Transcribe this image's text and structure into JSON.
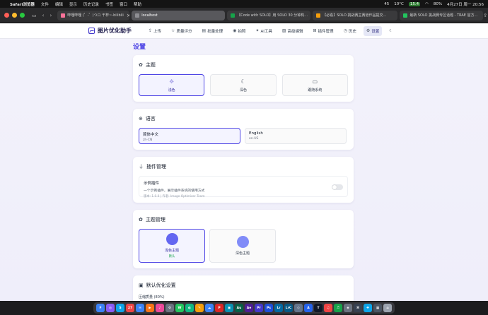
{
  "menubar": {
    "app": "Safari浏览器",
    "items": [
      "文件",
      "编辑",
      "显示",
      "历史记录",
      "书签",
      "窗口",
      "帮助"
    ],
    "status": {
      "num": "45",
      "temp": "10°C",
      "badge": "15.4",
      "battery": "80%",
      "datetime": "4月27日 周一 20:56"
    }
  },
  "browser": {
    "tabs": [
      {
        "label": "哔哩哔哩 (゜-゜)つロ 干杯~-bilibili",
        "color": "#fb7299"
      },
      {
        "label": "localhost",
        "color": "#8e8e93",
        "active": true
      },
      {
        "label": "【Code with SOLO】用 SOLO 30 分钟构...",
        "color": "#16a34a"
      },
      {
        "label": "【必看】SOLO 挑战赛主赛道作品提交...",
        "color": "#f59e0b"
      },
      {
        "label": "最新 SOLO 挑战赛专区话题 - TRAE 官方...",
        "color": "#22c55e"
      }
    ]
  },
  "app": {
    "brand": "图片优化助手",
    "nav": [
      {
        "label": "上传",
        "icon": "upload-icon",
        "glyph": "⇪"
      },
      {
        "label": "质量评分",
        "icon": "star-icon",
        "glyph": "☆"
      },
      {
        "label": "批量处理",
        "icon": "layers-icon",
        "glyph": "▤"
      },
      {
        "label": "拍照",
        "icon": "camera-icon",
        "glyph": "◉"
      },
      {
        "label": "AI工具",
        "icon": "sparkle-icon",
        "glyph": "✦"
      },
      {
        "label": "高级编辑",
        "icon": "image-icon",
        "glyph": "▨"
      },
      {
        "label": "插件管理",
        "icon": "grid-icon",
        "glyph": "⊞"
      },
      {
        "label": "历史",
        "icon": "clock-icon",
        "glyph": "◷"
      },
      {
        "label": "设置",
        "icon": "gear-icon",
        "glyph": "⚙",
        "active": true
      }
    ],
    "dark_toggle_glyph": "☾"
  },
  "settings": {
    "page_title": "设置",
    "theme": {
      "title": "主题",
      "options": [
        {
          "label": "浅色",
          "glyph": "☼",
          "selected": true
        },
        {
          "label": "深色",
          "glyph": "☾"
        },
        {
          "label": "跟随系统",
          "glyph": "▭"
        }
      ]
    },
    "language": {
      "title": "语言",
      "options": [
        {
          "name": "简体中文",
          "code": "zh-CN",
          "selected": true
        },
        {
          "name": "English",
          "code": "en-US"
        }
      ]
    },
    "plugins": {
      "title": "插件管理",
      "items": [
        {
          "name": "示例插件",
          "desc": "一个示例插件，展示插件系统的使用方式",
          "meta": "版本: 1.0.0 | 作者: Image Optimizer Team",
          "enabled": false
        }
      ]
    },
    "theme_manager": {
      "title": "主题管理",
      "options": [
        {
          "label": "浅色主题",
          "color": "#6366f1",
          "default_label": "默认",
          "selected": true
        },
        {
          "label": "深色主题",
          "color": "#818cf8"
        }
      ]
    },
    "defaults": {
      "title": "默认优化设置",
      "quality_label": "压缩质量 (80%)"
    }
  },
  "dock": [
    {
      "label": "F",
      "color": "#3b82f6"
    },
    {
      "label": "◎",
      "color": "#8b5cf6"
    },
    {
      "label": "S",
      "color": "#0ea5e9"
    },
    {
      "label": "27",
      "color": "#ef4444"
    },
    {
      "label": "✉",
      "color": "#3b82f6"
    },
    {
      "label": "▶",
      "color": "#f97316"
    },
    {
      "label": "♪",
      "color": "#ec4899"
    },
    {
      "label": "⚙",
      "color": "#6b7280"
    },
    {
      "label": "W",
      "color": "#22c55e"
    },
    {
      "label": "◐",
      "color": "#10b981"
    },
    {
      "label": "✎",
      "color": "#f59e0b"
    },
    {
      "label": "☁",
      "color": "#3b82f6"
    },
    {
      "label": "P",
      "color": "#dc2626"
    },
    {
      "label": "▣",
      "color": "#0891b2"
    },
    {
      "label": "Au",
      "color": "#065f46"
    },
    {
      "label": "Ae",
      "color": "#4c1d95"
    },
    {
      "label": "Pr",
      "color": "#4338ca"
    },
    {
      "label": "Ps",
      "color": "#1d4ed8"
    },
    {
      "label": "Lr",
      "color": "#0369a1"
    },
    {
      "label": "LrC",
      "color": "#075985"
    },
    {
      "label": "◇",
      "color": "#64748b"
    },
    {
      "label": "A",
      "color": "#2563eb"
    },
    {
      "label": "T",
      "color": "#111827"
    },
    {
      "label": "♫",
      "color": "#ef4444"
    },
    {
      "label": "♬",
      "color": "#16a34a"
    },
    {
      "label": "◈",
      "color": "#6b7280"
    },
    {
      "label": "⌘",
      "color": "#374151"
    },
    {
      "label": "✚",
      "color": "#0ea5e9"
    },
    {
      "label": "▦",
      "color": "#4b5563"
    },
    {
      "label": "⌂",
      "color": "#9ca3af"
    }
  ]
}
